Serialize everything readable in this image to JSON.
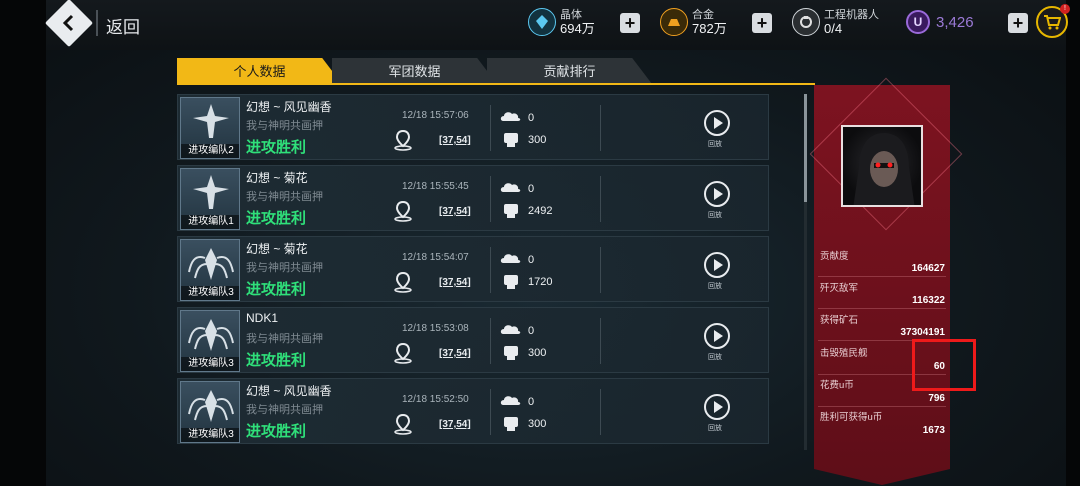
{
  "header": {
    "back_label": "返回",
    "resources": [
      {
        "label": "晶体",
        "value": "694万",
        "icon": "crystal-icon",
        "color": "#5bc8f0"
      },
      {
        "label": "合金",
        "value": "782万",
        "icon": "alloy-icon",
        "color": "#f0a020"
      },
      {
        "label": "工程机器人",
        "value": "0/4",
        "icon": "robot-icon",
        "color": "#e0e0e0"
      }
    ],
    "ucoin": {
      "symbol": "U",
      "value": "3,426"
    },
    "cart_badge": "!"
  },
  "tabs": [
    {
      "label": "个人数据",
      "active": true
    },
    {
      "label": "军团数据",
      "active": false
    },
    {
      "label": "贡献排行",
      "active": false
    }
  ],
  "battles": [
    {
      "player": "幻想 ~ 风见幽香",
      "guild": "我与神明共画押",
      "result": "进攻胜利",
      "time": "12/18 15:57:06",
      "coord": "[37,54]",
      "cloud": "0",
      "power": "300",
      "fleet": "进攻编队2",
      "ship": "ship-icon",
      "replay": "回放"
    },
    {
      "player": "幻想 ~ 菊花",
      "guild": "我与神明共画押",
      "result": "进攻胜利",
      "time": "12/18 15:55:45",
      "coord": "[37,54]",
      "cloud": "0",
      "power": "2492",
      "fleet": "进攻编队1",
      "ship": "ship-icon",
      "replay": "回放"
    },
    {
      "player": "幻想 ~ 菊花",
      "guild": "我与神明共画押",
      "result": "进攻胜利",
      "time": "12/18 15:54:07",
      "coord": "[37,54]",
      "cloud": "0",
      "power": "1720",
      "fleet": "进攻编队3",
      "ship": "spider-ship-icon",
      "replay": "回放"
    },
    {
      "player": "NDK1",
      "guild": "我与神明共画押",
      "result": "进攻胜利",
      "time": "12/18 15:53:08",
      "coord": "[37,54]",
      "cloud": "0",
      "power": "300",
      "fleet": "进攻编队3",
      "ship": "spider-ship-icon",
      "replay": "回放"
    },
    {
      "player": "幻想 ~ 风见幽香",
      "guild": "我与神明共画押",
      "result": "进攻胜利",
      "time": "12/18 15:52:50",
      "coord": "[37,54]",
      "cloud": "0",
      "power": "300",
      "fleet": "进攻编队3",
      "ship": "spider-ship-icon",
      "replay": "回放"
    }
  ],
  "stats": [
    {
      "label": "贡献度",
      "value": "164627"
    },
    {
      "label": "歼灭敌军",
      "value": "116322"
    },
    {
      "label": "获得矿石",
      "value": "37304191"
    },
    {
      "label": "击毁殖民舰",
      "value": "60"
    },
    {
      "label": "花费u币",
      "value": "796"
    },
    {
      "label": "胜利可获得u币",
      "value": "1673"
    }
  ],
  "colors": {
    "accent": "#f2b816",
    "win": "#2fe07a",
    "panel": "#7d1320",
    "highlight": "#ee1a1a"
  }
}
